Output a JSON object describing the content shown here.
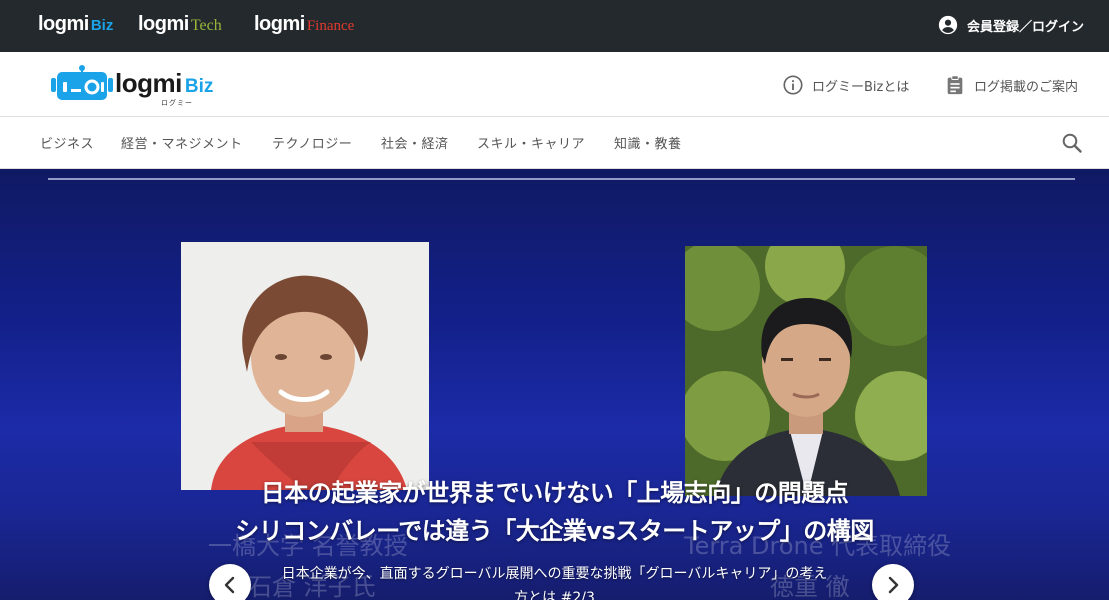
{
  "services": [
    {
      "main": "logmi",
      "sub": "Biz"
    },
    {
      "main": "logmi",
      "sub": "Tech"
    },
    {
      "main": "logmi",
      "sub": "Finance"
    }
  ],
  "account": {
    "login_label": "会員登録／ログイン"
  },
  "header": {
    "logo_main": "logmi",
    "logo_sub": "Biz",
    "logo_kana": "ログミー",
    "about_label": "ログミーBizとは",
    "guide_label": "ログ掲載のご案内"
  },
  "nav": {
    "categories": [
      "ビジネス",
      "経営・マネジメント",
      "テクノロジー",
      "社会・経済",
      "スキル・キャリア",
      "知識・教養"
    ]
  },
  "hero": {
    "headline_1": "日本の起業家が世界までいけない「上場志向」の問題点",
    "headline_2": "シリコンバレーでは違う「大企業vsスタートアップ」の構図",
    "description_1": "日本企業が今、直面するグローバル展開への重要な挑戦「グローバルキャリア」の考え",
    "description_2": "方とは #2/3",
    "speaker_left_title": "一橋大学 名誉教授",
    "speaker_left_name": "石倉 洋子氏",
    "speaker_right_title": "Terra Drone 代表取締役",
    "speaker_right_name": "徳重 徹"
  },
  "colors": {
    "topbar": "#24292d",
    "brand_blue": "#1aa3e8",
    "tech_green": "#9ab838",
    "finance_red": "#e23b2f",
    "hero_blue": "#1c2ba8"
  },
  "icons": {
    "login": "account-circle-icon",
    "about": "info-icon",
    "guide": "clipboard-icon",
    "search": "search-icon",
    "prev": "chevron-left-icon",
    "next": "chevron-right-icon"
  }
}
